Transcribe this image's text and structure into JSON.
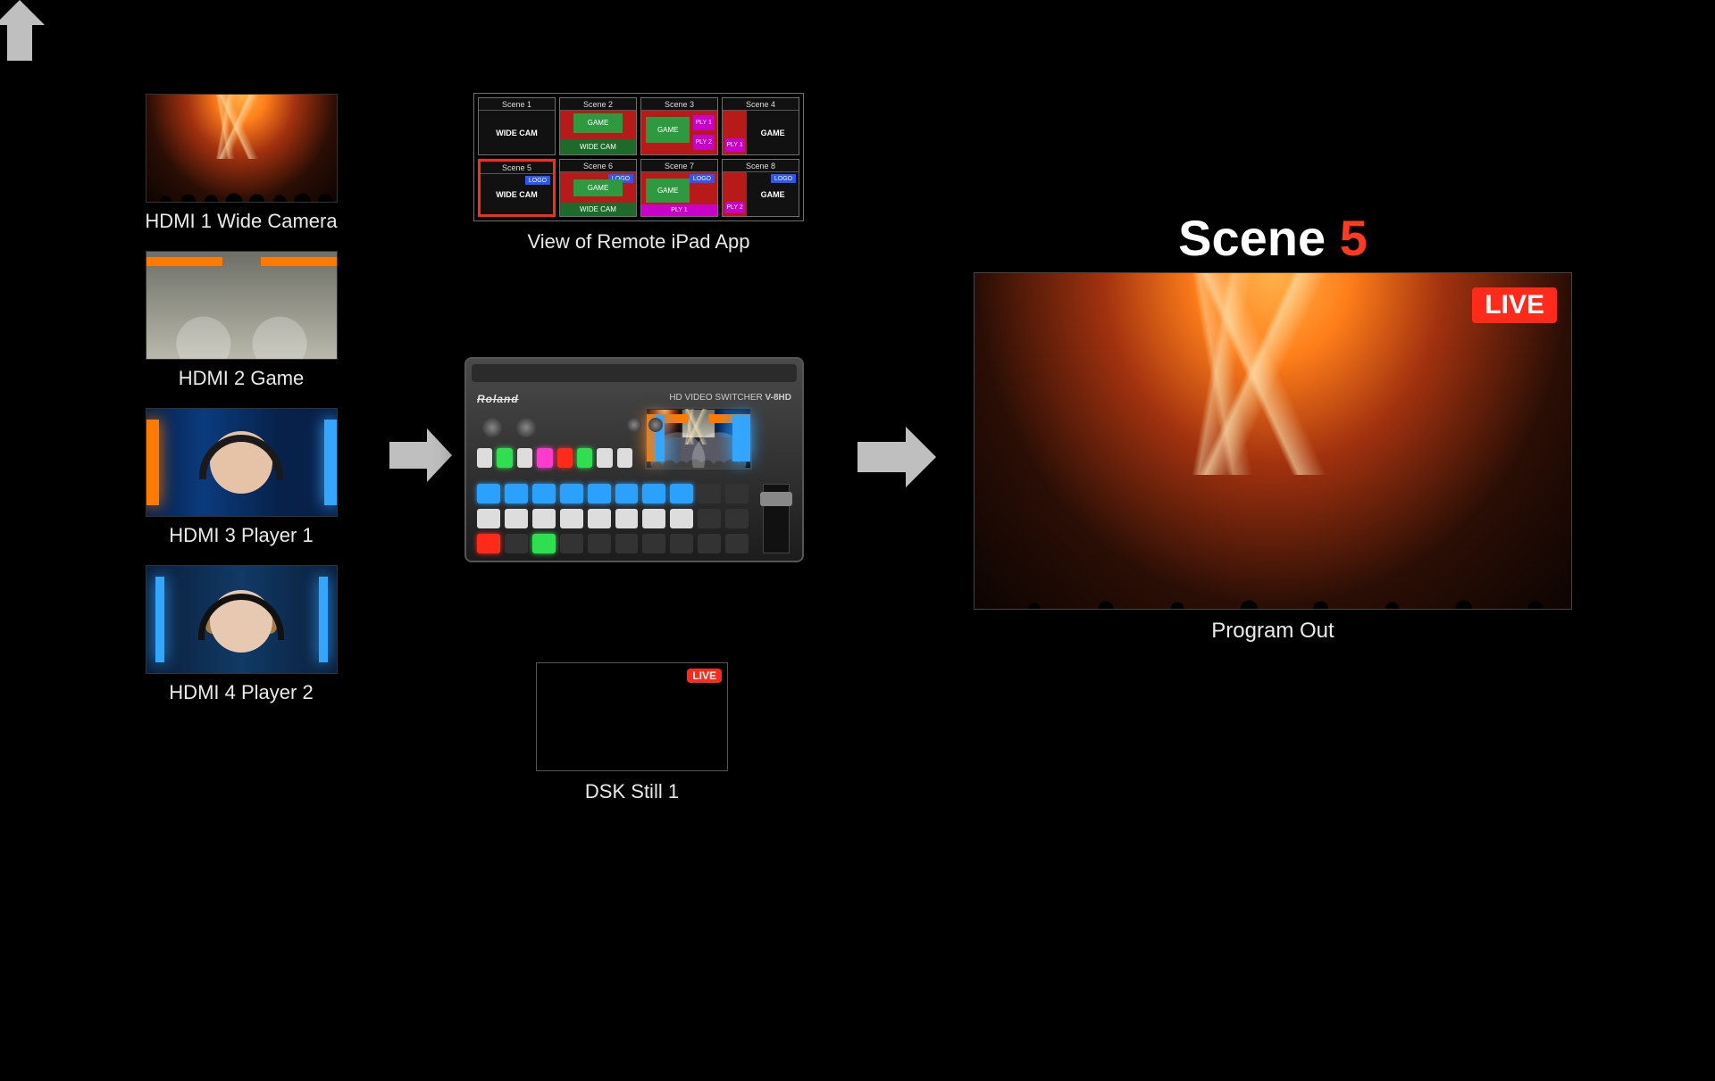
{
  "inputs": [
    {
      "label": "HDMI 1 Wide Camera"
    },
    {
      "label": "HDMI 2 Game"
    },
    {
      "label": "HDMI 3 Player 1"
    },
    {
      "label": "HDMI 4 Player 2"
    }
  ],
  "ipad": {
    "caption": "View of Remote iPad App",
    "scenes": [
      {
        "title": "Scene 1",
        "selected": false
      },
      {
        "title": "Scene 2",
        "selected": false
      },
      {
        "title": "Scene 3",
        "selected": false
      },
      {
        "title": "Scene 4",
        "selected": false
      },
      {
        "title": "Scene 5",
        "selected": true
      },
      {
        "title": "Scene 6",
        "selected": false
      },
      {
        "title": "Scene 7",
        "selected": false
      },
      {
        "title": "Scene 8",
        "selected": false
      }
    ],
    "blocks": {
      "widecam": "WIDE CAM",
      "game": "GAME",
      "logo": "LOGO",
      "ply1": "PLY 1",
      "ply2": "PLY 2"
    }
  },
  "device": {
    "brand": "Roland",
    "model_prefix": "HD VIDEO SWITCHER",
    "model": "V-8HD"
  },
  "dsk": {
    "label": "DSK Still 1",
    "badge": "LIVE"
  },
  "program": {
    "title_prefix": "Scene ",
    "title_num": "5",
    "caption": "Program Out",
    "badge": "LIVE"
  }
}
